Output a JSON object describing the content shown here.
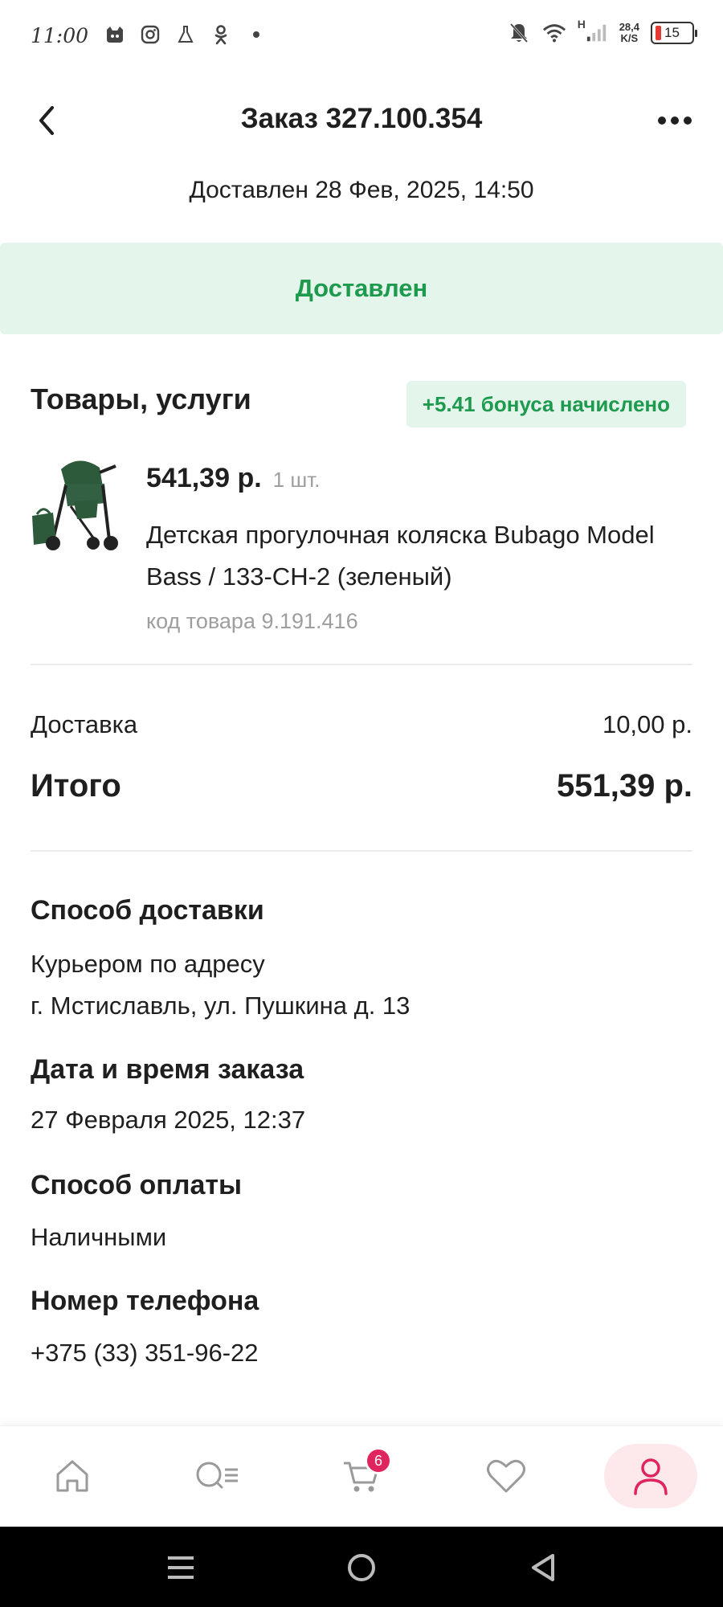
{
  "status_bar": {
    "time": "11:00",
    "network_speed_value": "28,4",
    "network_speed_unit": "K/S",
    "network_type": "H",
    "battery": "15",
    "icons": [
      "cat-app-icon",
      "instagram-icon",
      "flask-icon",
      "odnoklassniki-icon",
      "dot-icon",
      "bell-off-icon",
      "wifi-icon",
      "signal-icon",
      "battery-icon"
    ]
  },
  "header": {
    "title": "Заказ 327.100.354",
    "subtitle": "Доставлен 28 Фев, 2025, 14:50"
  },
  "banner": {
    "status": "Доставлен"
  },
  "goods": {
    "title": "Товары, услуги",
    "bonus": "+5.41 бонуса начислено",
    "item": {
      "price": "541,39 р.",
      "qty": "1 шт.",
      "name": "Детская прогулочная коляска Bubago Model Bass / 133-CH-2 (зеленый)",
      "code": "код товара 9.191.416"
    }
  },
  "summary": {
    "delivery_label": "Доставка",
    "delivery_value": "10,00 р.",
    "total_label": "Итого",
    "total_value": "551,39 р."
  },
  "info": {
    "delivery_method_title": "Способ доставки",
    "delivery_method_line1": "Курьером по адресу",
    "delivery_method_line2": "г. Мстиславль, ул. Пушкина д. 13",
    "order_date_title": "Дата и время заказа",
    "order_date_value": "27 Февраля 2025, 12:37",
    "payment_title": "Способ оплаты",
    "payment_value": "Наличными",
    "phone_title": "Номер телефона",
    "phone_value": "+375 (33) 351-96-22"
  },
  "bottom_nav": {
    "items": [
      "home-icon",
      "search-catalog-icon",
      "cart-icon",
      "heart-icon",
      "profile-icon"
    ],
    "active": "profile-icon",
    "cart_count": "6"
  },
  "colors": {
    "accent_green": "#1e9a4f",
    "banner_bg": "#e4f5ec",
    "badge_pink": "#e0245e",
    "active_nav_bg": "#fde8ec"
  }
}
